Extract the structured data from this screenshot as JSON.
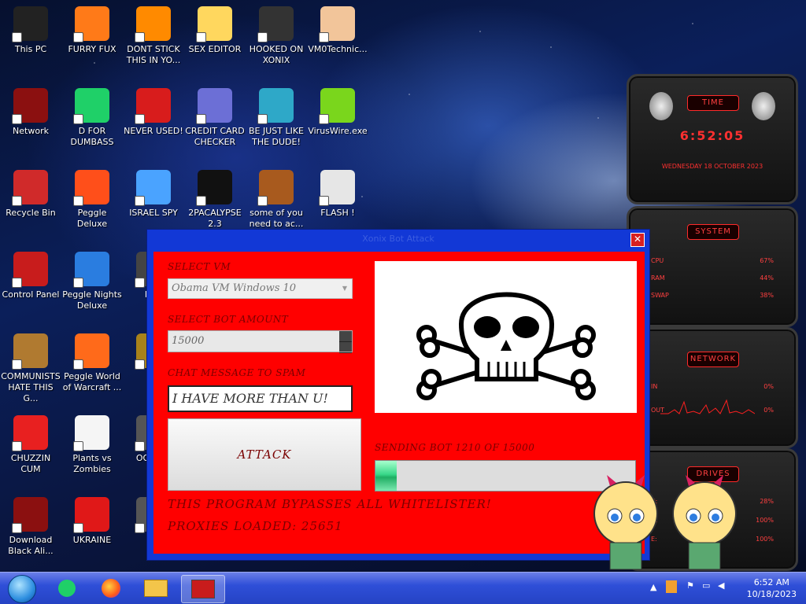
{
  "desktop_icons": [
    {
      "label": "This PC",
      "icon": "computer-icon",
      "color": "#222"
    },
    {
      "label": "FURRY FUX",
      "icon": "firefox-icon",
      "color": "#ff7a18"
    },
    {
      "label": "DONT STICK THIS IN YO...",
      "icon": "vlc-cone-icon",
      "color": "#ff8a00"
    },
    {
      "label": "SEX EDITOR",
      "icon": "cartoon-face-icon",
      "color": "#ffd75e"
    },
    {
      "label": "HOOKED ON XONIX",
      "icon": "game-icon",
      "color": "#333"
    },
    {
      "label": "VM0Technic...",
      "icon": "doctor-icon",
      "color": "#f2c59a"
    },
    {
      "label": "Network",
      "icon": "alienware-icon",
      "color": "#8b1010"
    },
    {
      "label": "D FOR DUMBASS",
      "icon": "dictionary-icon",
      "color": "#1fd068"
    },
    {
      "label": "NEVER USED!",
      "icon": "devcpp-icon",
      "color": "#d81c1c"
    },
    {
      "label": "CREDIT CARD CHECKER",
      "icon": "credit-card-icon",
      "color": "#6c6fd6"
    },
    {
      "label": "BE JUST LIKE THE DUDE!",
      "icon": "santa-elf-icon",
      "color": "#2ea8c8"
    },
    {
      "label": "VirusWire.exe",
      "icon": "lime-icon",
      "color": "#7ad61c"
    },
    {
      "label": "Recycle Bin",
      "icon": "trash-bin-icon",
      "color": "#d02a2a"
    },
    {
      "label": "Peggle Deluxe",
      "icon": "peggle-icon",
      "color": "#ff4f1a"
    },
    {
      "label": "ISRAEL SPY",
      "icon": "network-spy-icon",
      "color": "#4aa3ff"
    },
    {
      "label": "2PACALYPSE 2.3",
      "icon": "terminal-icon",
      "color": "#111"
    },
    {
      "label": "some of you need to ac...",
      "icon": "dog-icon",
      "color": "#a85a1e"
    },
    {
      "label": "FLASH !",
      "icon": "flash-doc-icon",
      "color": "#e6e6e6"
    },
    {
      "label": "Control Panel",
      "icon": "control-panel-icon",
      "color": "#c81c1c"
    },
    {
      "label": "Peggle Nights Deluxe",
      "icon": "peggle-nights-icon",
      "color": "#2a7de0"
    },
    {
      "label": "DEE",
      "icon": "generic-app-icon",
      "color": "#444"
    },
    {
      "label": "COMMUNISTS HATE THIS G...",
      "icon": "money-bag-icon",
      "color": "#b07a30"
    },
    {
      "label": "Peggle World of Warcraft ...",
      "icon": "peggle-wow-icon",
      "color": "#ff6a1a"
    },
    {
      "label": "DIE",
      "icon": "generic-app-icon",
      "color": "#a8821a"
    },
    {
      "label": "CHUZZIN CUM",
      "icon": "chuzzle-icon",
      "color": "#e82020"
    },
    {
      "label": "Plants vs Zombies",
      "icon": "plants-vs-zombies-icon",
      "color": "#f5f5f5"
    },
    {
      "label": "OOF DO",
      "icon": "generic-app-icon",
      "color": "#555"
    },
    {
      "label": "Download Black Ali...",
      "icon": "alienware-icon",
      "color": "#8b1010"
    },
    {
      "label": "UKRAINE",
      "icon": "radiation-icon",
      "color": "#e01818"
    },
    {
      "label": "C",
      "icon": "generic-app-icon",
      "color": "#555"
    }
  ],
  "widgets": {
    "time": {
      "title": "TIME",
      "clock": "6:52:05",
      "date": "WEDNESDAY 18 OCTOBER 2023"
    },
    "system": {
      "title": "SYSTEM",
      "rows": [
        {
          "label": "CPU",
          "value": "67%"
        },
        {
          "label": "RAM",
          "value": "44%"
        },
        {
          "label": "SWAP",
          "value": "38%"
        }
      ]
    },
    "network": {
      "title": "NETWORK",
      "rows": [
        {
          "label": "IN",
          "value": "0%"
        },
        {
          "label": "OUT",
          "value": "0%"
        }
      ]
    },
    "drives": {
      "title": "DRIVES",
      "rows": [
        {
          "label": "C:",
          "value": "28%"
        },
        {
          "label": "D:",
          "value": "100%"
        },
        {
          "label": "E:",
          "value": "100%"
        }
      ]
    }
  },
  "app": {
    "title": "Xonix Bot Attack",
    "select_vm_label": "SELECT VM",
    "vm_selected": "Obama VM Windows 10",
    "bot_amount_label": "SELECT BOT AMOUNT",
    "bot_amount_value": "15000",
    "chat_label": "CHAT MESSAGE TO SPAM",
    "chat_value": "I HAVE MORE THAN U!",
    "attack_label": "ATTACK",
    "status_text": "SENDING BOT 1210 OF 15000",
    "progress": 0.081,
    "bypass_text": "THIS PROGRAM BYPASSES ALL WHITELISTER!",
    "proxies_text": "PROXIES LOADED: 25651",
    "image_icon": "skull-and-crossbones-icon",
    "panel_color": "#ff0000",
    "frame_color": "#1238d6"
  },
  "taskbar": {
    "time": "6:52 AM",
    "date": "10/18/2023",
    "apps": [
      "start-orb-icon",
      "dictionary-icon",
      "firefox-icon",
      "file-explorer-icon",
      "control-panel-icon"
    ]
  }
}
